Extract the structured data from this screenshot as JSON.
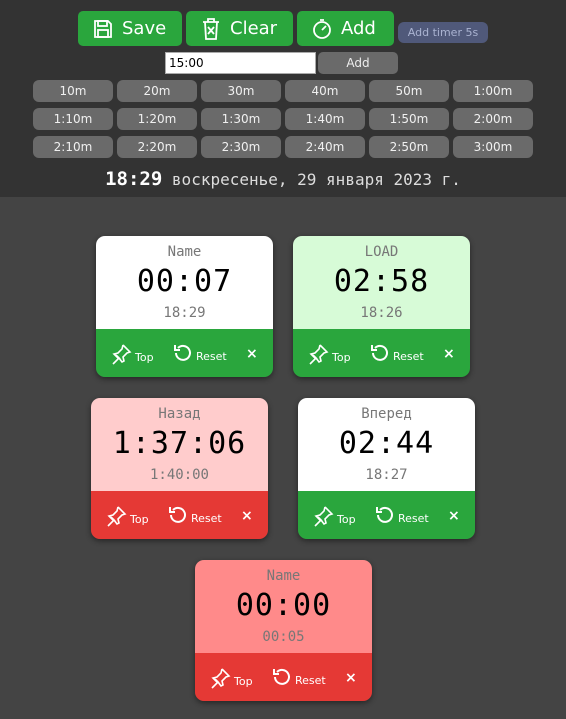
{
  "toolbar": {
    "save_label": "Save",
    "clear_label": "Clear",
    "add_label": "Add",
    "add_timer_5s_label": "Add timer 5s"
  },
  "time_input": {
    "value": "15:00"
  },
  "add_button_label": "Add",
  "presets": [
    "10m",
    "20m",
    "30m",
    "40m",
    "50m",
    "1:00m",
    "1:10m",
    "1:20m",
    "1:30m",
    "1:40m",
    "1:50m",
    "2:00m",
    "2:10m",
    "2:20m",
    "2:30m",
    "2:40m",
    "2:50m",
    "3:00m"
  ],
  "clock": {
    "time": "18:29",
    "date": "воскресенье, 29 января 2023 г."
  },
  "card_labels": {
    "top": "Top",
    "reset": "Reset",
    "close": "×"
  },
  "timers": [
    {
      "name": "Name",
      "time": "00:07",
      "sub": "18:29",
      "body_color": "#ffffff",
      "bar_color": "#2aa63d"
    },
    {
      "name": "LOAD",
      "time": "02:58",
      "sub": "18:26",
      "body_color": "#d7fbd7",
      "bar_color": "#2aa63d"
    },
    {
      "name": "Назад",
      "time": "1:37:06",
      "sub": "1:40:00",
      "body_color": "#ffcccc",
      "bar_color": "#e53935"
    },
    {
      "name": "Вперед",
      "time": "02:44",
      "sub": "18:27",
      "body_color": "#ffffff",
      "bar_color": "#2aa63d"
    },
    {
      "name": "Name",
      "time": "00:00",
      "sub": "00:05",
      "body_color": "#ff8a8a",
      "bar_color": "#e53935"
    }
  ]
}
